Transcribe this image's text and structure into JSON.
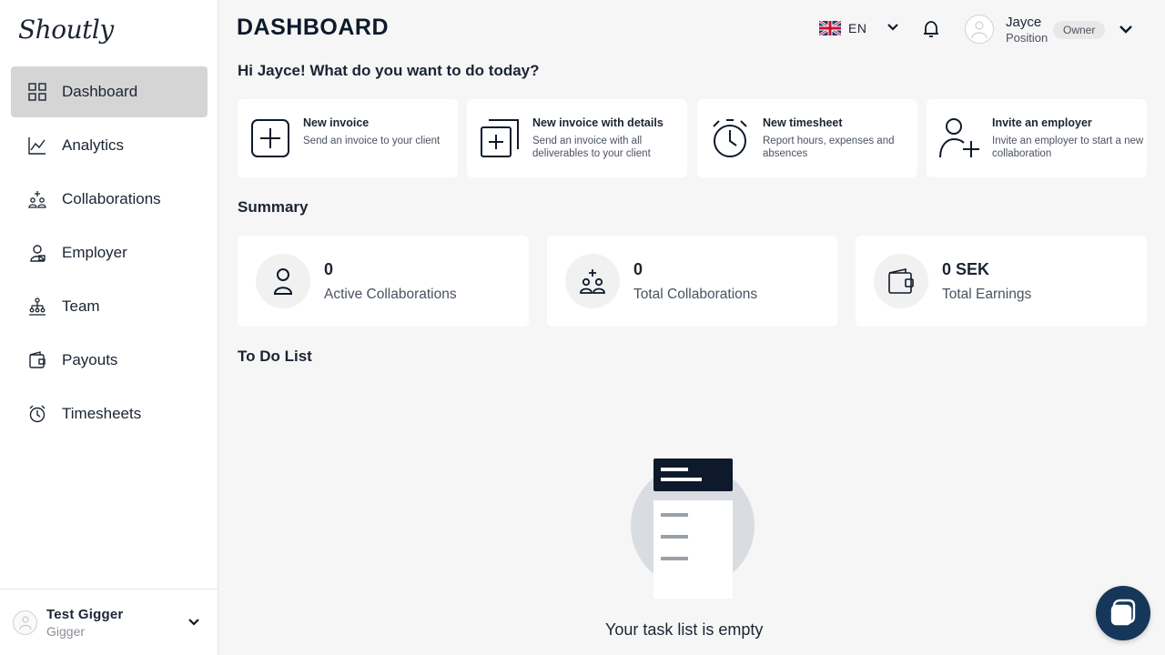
{
  "app": {
    "logo": "Shoutly"
  },
  "sidebar": {
    "items": [
      {
        "label": "Dashboard",
        "icon": "dashboard-grid-icon",
        "active": true
      },
      {
        "label": "Analytics",
        "icon": "chart-line-icon"
      },
      {
        "label": "Collaborations",
        "icon": "people-plus-icon"
      },
      {
        "label": "Employer",
        "icon": "employer-person-icon"
      },
      {
        "label": "Team",
        "icon": "team-icon"
      },
      {
        "label": "Payouts",
        "icon": "wallet-icon"
      },
      {
        "label": "Timesheets",
        "icon": "stopwatch-icon"
      }
    ],
    "footer": {
      "name": "Test Gigger",
      "role": "Gigger"
    }
  },
  "header": {
    "title": "DASHBOARD",
    "language": "EN",
    "user": {
      "name": "Jayce",
      "position": "Position",
      "badge": "Owner"
    }
  },
  "greeting": "Hi Jayce! What do you want to do today?",
  "actions": [
    {
      "title": "New invoice",
      "desc": "Send an invoice to your client",
      "icon": "plus-square-icon"
    },
    {
      "title": "New invoice with details",
      "desc": "Send an invoice with all deliverables to your client",
      "icon": "plus-stack-icon"
    },
    {
      "title": "New timesheet",
      "desc": "Report hours, expenses and absences",
      "icon": "stopwatch-icon"
    },
    {
      "title": "Invite an employer",
      "desc": "Invite an employer to start a new collaboration",
      "icon": "person-add-icon"
    }
  ],
  "summary": {
    "title": "Summary",
    "cards": [
      {
        "value": "0",
        "label": "Active Collaborations",
        "icon": "person-icon"
      },
      {
        "value": "0",
        "label": "Total Collaborations",
        "icon": "people-plus-icon"
      },
      {
        "value": "0 SEK",
        "label": "Total Earnings",
        "icon": "wallet-icon"
      }
    ]
  },
  "todo": {
    "title": "To Do List",
    "empty_text": "Your task list is empty"
  },
  "colors": {
    "primary": "#0e1a2b",
    "active_nav": "#d5d5d5",
    "chat": "#16375a",
    "background": "#f6f6f6"
  }
}
